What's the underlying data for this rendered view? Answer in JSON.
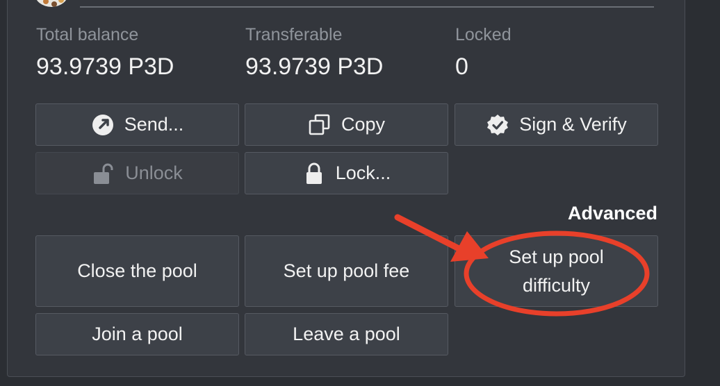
{
  "balances": [
    {
      "label": "Total balance",
      "value": "93.9739 P3D"
    },
    {
      "label": "Transferable",
      "value": "93.9739 P3D"
    },
    {
      "label": "Locked",
      "value": "0"
    }
  ],
  "actions": {
    "send": "Send...",
    "copy": "Copy",
    "sign_verify": "Sign & Verify",
    "unlock": "Unlock",
    "lock": "Lock..."
  },
  "advanced": {
    "heading": "Advanced",
    "close_pool": "Close the pool",
    "pool_fee": "Set up pool fee",
    "pool_difficulty": "Set up pool difficulty",
    "join_pool": "Join a pool",
    "leave_pool": "Leave a pool"
  },
  "annotation": {
    "color": "#e8402a"
  }
}
